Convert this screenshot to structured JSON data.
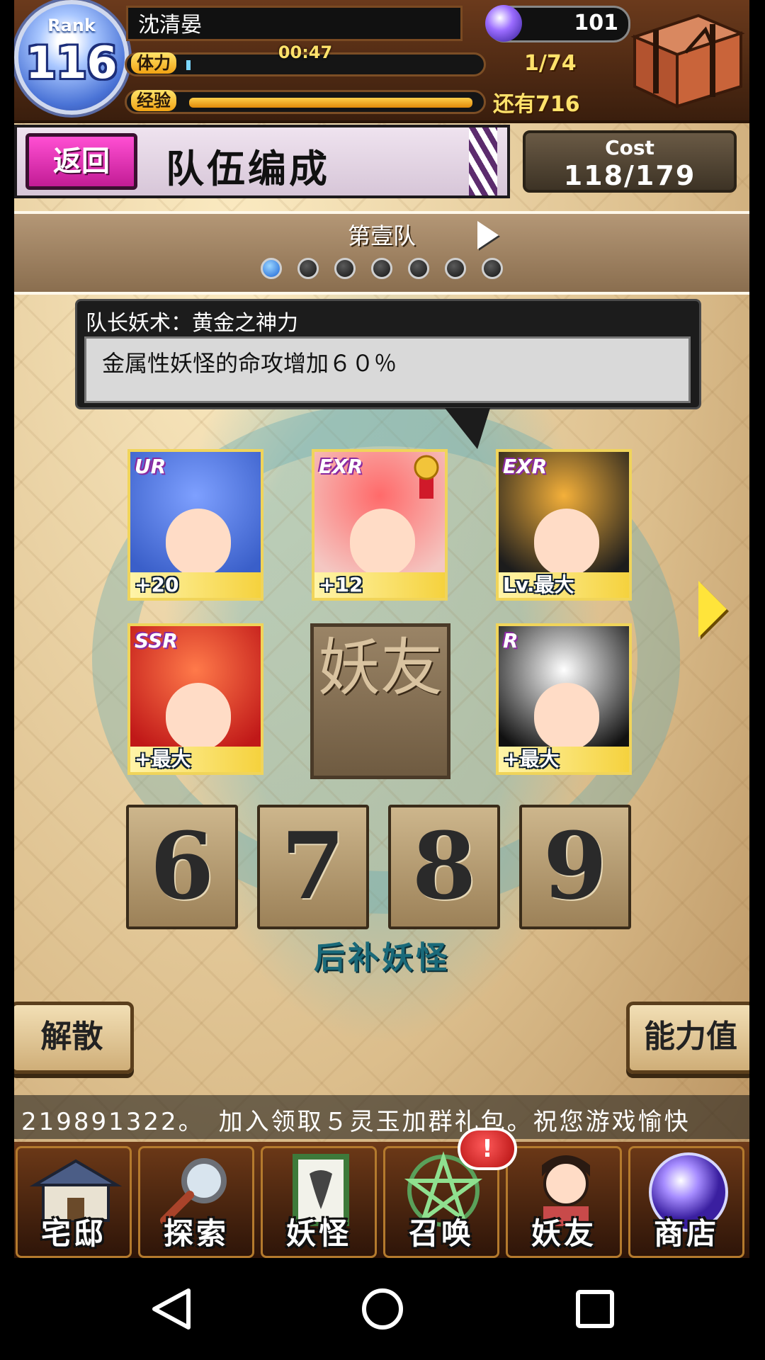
{
  "player": {
    "rank_label": "Rank",
    "rank": "116",
    "name": "沈清晏",
    "gems": "101",
    "stamina_label": "体力",
    "stamina_timer": "00:47",
    "stamina_count": "1/74",
    "exp_label": "经验",
    "exp_remaining": "还有716"
  },
  "header": {
    "back_label": "返回",
    "title": "队伍编成",
    "cost_label": "Cost",
    "cost_value": "118/179"
  },
  "party": {
    "name": "第壹队",
    "page_count": 7,
    "active_index": 0
  },
  "leader_skill": {
    "title": "队长妖术：黄金之神力",
    "description": "金属性妖怪的命攻增加６０％"
  },
  "members": [
    {
      "rarity": "UR",
      "level_text": "+20",
      "colors": [
        "#3a5fc9",
        "#7ea0ff"
      ]
    },
    {
      "rarity": "EXR",
      "level_text": "+12",
      "colors": [
        "#f4c7c2",
        "#ff6a6a"
      ],
      "leader": true
    },
    {
      "rarity": "EXR",
      "level_text": "Lv.最大",
      "colors": [
        "#1c1c1c",
        "#f4b03a"
      ]
    },
    {
      "rarity": "SSR",
      "level_text": "+最大",
      "colors": [
        "#c01818",
        "#ff7a4a"
      ]
    },
    {
      "rarity": "R",
      "level_text": "+最大",
      "colors": [
        "#111111",
        "#ffffff"
      ]
    }
  ],
  "friend_slot_label": "妖友",
  "reserve_slots": [
    "6",
    "7",
    "8",
    "9"
  ],
  "reserve_label": "后补妖怪",
  "actions": {
    "disband": "解散",
    "stats": "能力值"
  },
  "ticker": "219891322。　加入领取５灵玉加群礼包。祝您游戏愉快",
  "nav": [
    {
      "label": "宅邸",
      "icon": "mansion-icon",
      "color": "#4b5d86"
    },
    {
      "label": "探索",
      "icon": "magnifier-icon",
      "color": "#8a8f9a"
    },
    {
      "label": "妖怪",
      "icon": "scroll-icon",
      "color": "#3e7a3a"
    },
    {
      "label": "召唤",
      "icon": "pentagram-icon",
      "color": "#3f7b3f"
    },
    {
      "label": "妖友",
      "icon": "friend-icon",
      "color": "#c84a4a"
    },
    {
      "label": "商店",
      "icon": "crystal-orb-icon",
      "color": "#7a5ad6"
    }
  ],
  "summon_badge": "!",
  "colors": {
    "accent_pink": "#d62aa8",
    "gold": "#f5d23e",
    "crest_teal": "#5faab4"
  }
}
